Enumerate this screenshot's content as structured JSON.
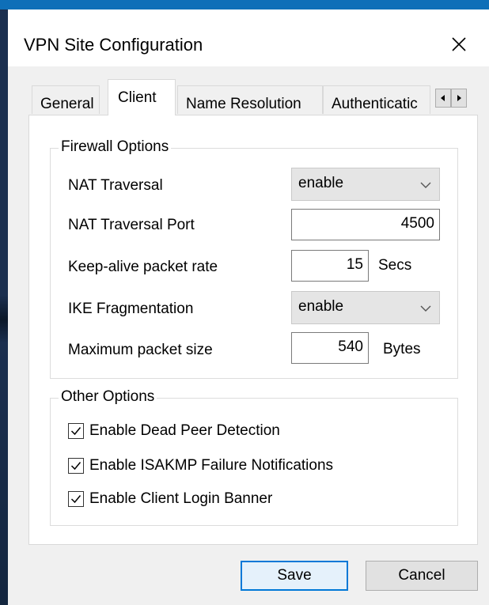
{
  "window": {
    "title": "VPN Site Configuration"
  },
  "tabs": [
    {
      "label": "General",
      "active": false
    },
    {
      "label": "Client",
      "active": true
    },
    {
      "label": "Name Resolution",
      "active": false
    },
    {
      "label": "Authenticatic",
      "active": false
    }
  ],
  "icons": {
    "close": "close-icon",
    "tab_prev": "triangle-left-icon",
    "tab_next": "triangle-right-icon",
    "dropdown": "chevron-down-icon",
    "check": "checkmark-icon"
  },
  "firewall": {
    "group_label": "Firewall Options",
    "nat_traversal": {
      "label": "NAT Traversal",
      "value": "enable"
    },
    "nat_traversal_port": {
      "label": "NAT Traversal Port",
      "value": "4500"
    },
    "keepalive": {
      "label": "Keep-alive packet rate",
      "value": "15",
      "unit": "Secs"
    },
    "ike_fragmentation": {
      "label": "IKE Fragmentation",
      "value": "enable"
    },
    "max_packet": {
      "label": "Maximum packet size",
      "value": "540",
      "unit": "Bytes"
    }
  },
  "other": {
    "group_label": "Other Options",
    "options": [
      {
        "label": "Enable Dead Peer Detection",
        "checked": true
      },
      {
        "label": "Enable ISAKMP Failure Notifications",
        "checked": true
      },
      {
        "label": "Enable Client Login Banner",
        "checked": true
      }
    ]
  },
  "buttons": {
    "save": "Save",
    "cancel": "Cancel"
  },
  "colors": {
    "accent": "#0078d7",
    "desktop_top": "#0e6fb8",
    "dialog_bg": "#f0f0f0"
  }
}
